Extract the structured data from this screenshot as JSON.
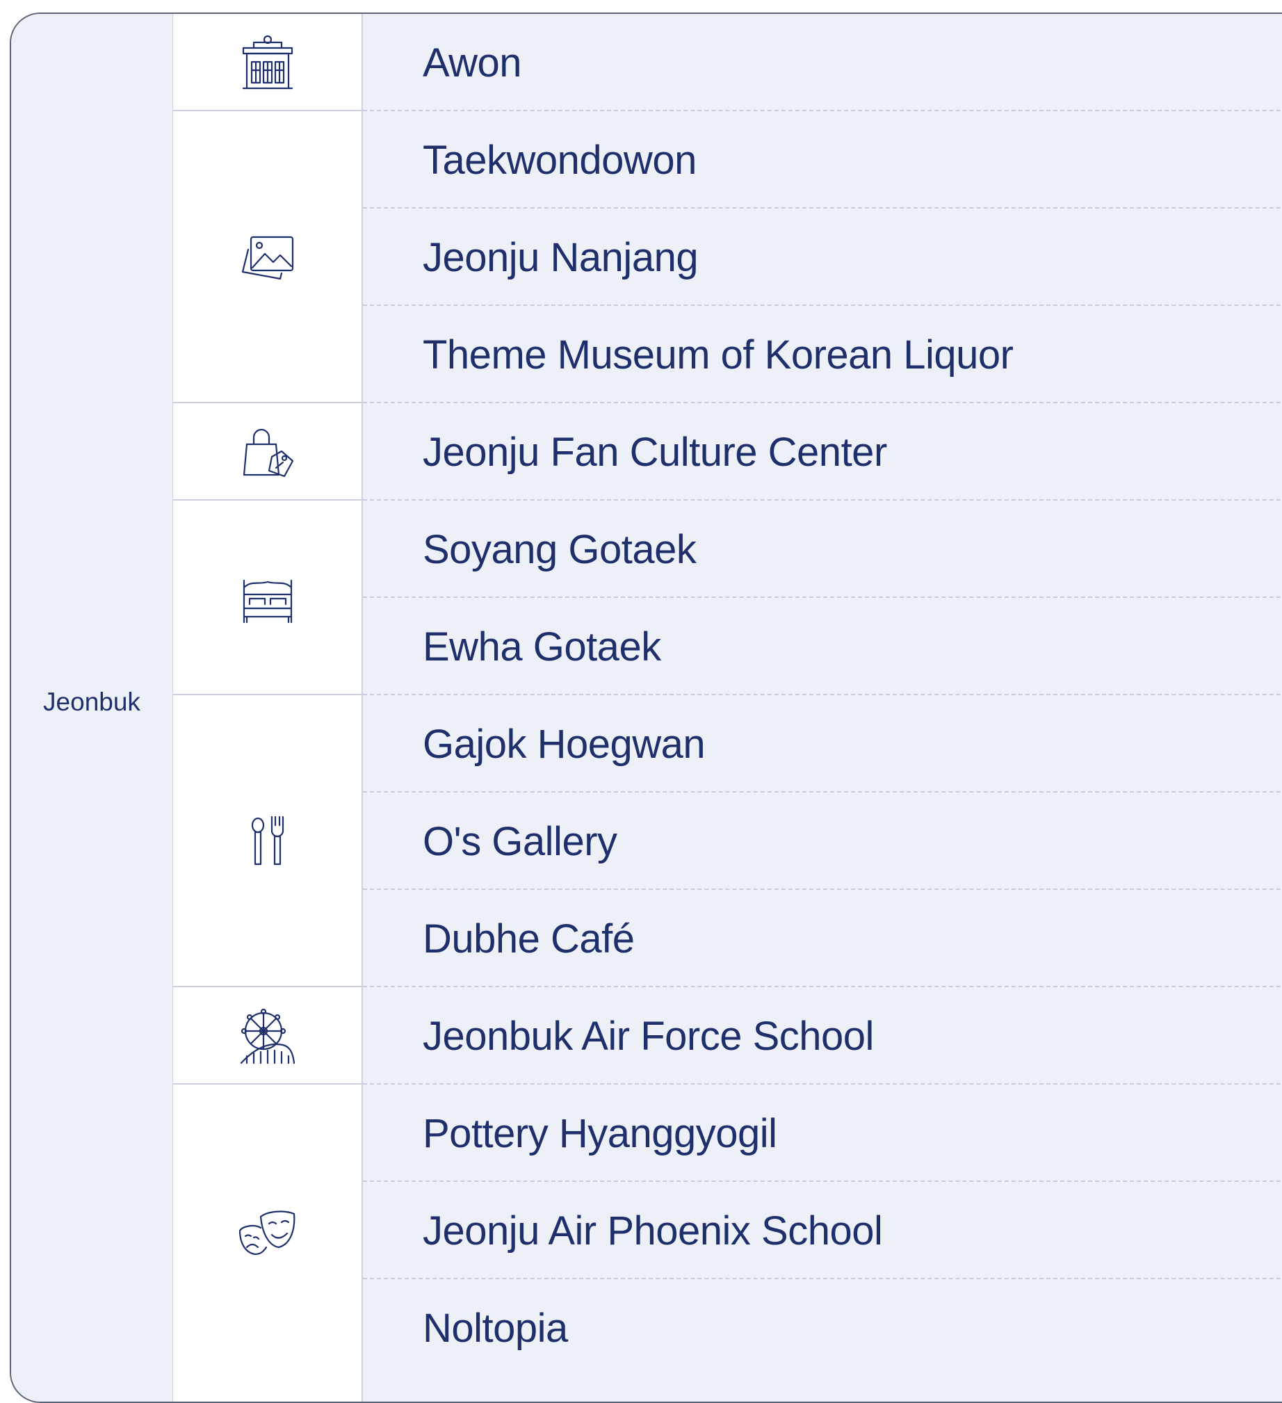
{
  "region": "Jeonbuk",
  "categories": [
    {
      "icon": "building-icon"
    },
    {
      "icon": "gallery-icon"
    },
    {
      "icon": "shopping-bag-icon"
    },
    {
      "icon": "bed-icon"
    },
    {
      "icon": "restaurant-icon"
    },
    {
      "icon": "amusement-park-icon"
    },
    {
      "icon": "theater-masks-icon"
    }
  ],
  "places": [
    "Awon",
    "Taekwondowon",
    "Jeonju Nanjang",
    "Theme Museum of Korean Liquor",
    "Jeonju Fan Culture Center",
    "Soyang Gotaek",
    "Ewha Gotaek",
    "Gajok Hoegwan",
    "O's Gallery",
    "Dubhe Café",
    "Jeonbuk Air Force School",
    "Pottery Hyanggyogil",
    "Jeonju Air Phoenix School",
    "Noltopia"
  ]
}
